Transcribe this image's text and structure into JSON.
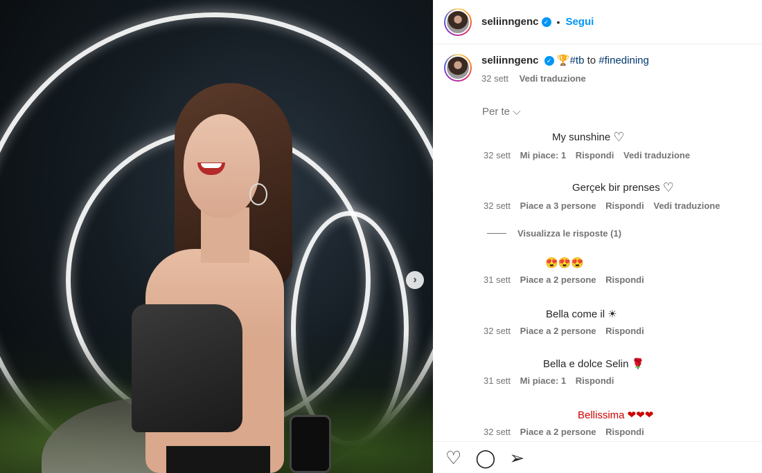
{
  "post": {
    "username": "seliinngenc",
    "follow_label": "Segui",
    "dot": "•",
    "caption_emoji": "🏆",
    "caption_tag1": "#tb",
    "caption_mid": "to",
    "caption_tag2": "#finedining",
    "caption_time": "32 sett",
    "caption_translate": "Vedi traduzione"
  },
  "per_te_label": "Per te ⌵",
  "comments": [
    {
      "text": "My sunshine",
      "time": "32 sett",
      "likes": "Mi piace: 1",
      "reply": "Rispondi",
      "translate": "Vedi traduzione"
    },
    {
      "text": "Gerçek bir prenses",
      "time": "32 sett",
      "likes": "Piace a 3 persone",
      "reply": "Rispondi",
      "translate": "Vedi traduzione"
    },
    {
      "text": "😍😍😍",
      "time": "31 sett",
      "likes": "Piace a 2 persone",
      "reply": "Rispondi"
    },
    {
      "text": "Bella come il ☀",
      "time": "32 sett",
      "likes": "Piace a 2 persone",
      "reply": "Rispondi"
    },
    {
      "text": "Bella e dolce Selin 🌹",
      "time": "31 sett",
      "likes": "Mi piace: 1",
      "reply": "Rispondi"
    },
    {
      "text": "Bellissima ❤❤❤",
      "time": "32 sett",
      "likes": "Piace a 2 persone",
      "reply": "Rispondi"
    }
  ],
  "view_replies": "Visualizza le risposte (1)",
  "icons": {
    "like": "heart-icon",
    "comment": "comment-icon",
    "share": "share-icon",
    "next": "chevron-right-icon"
  }
}
